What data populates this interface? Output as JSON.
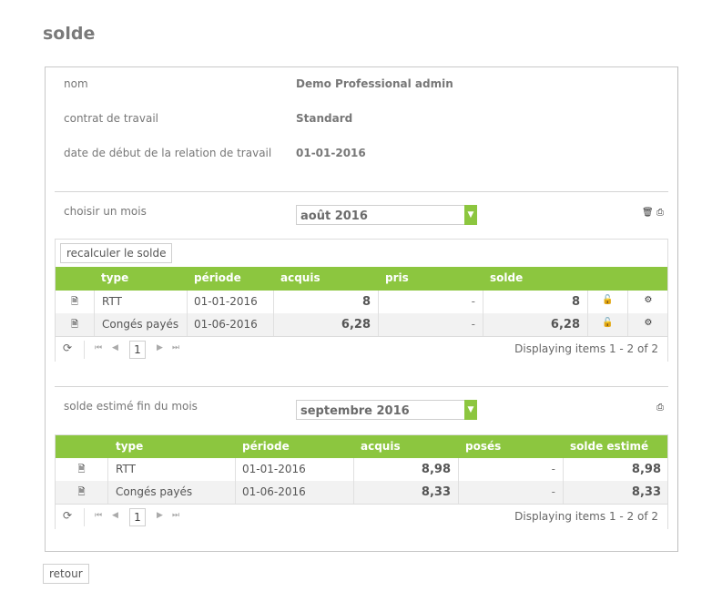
{
  "page": {
    "title": "solde"
  },
  "info": {
    "name_label": "nom",
    "name_value": "Demo Professional admin",
    "contract_label": "contrat de travail",
    "contract_value": "Standard",
    "start_label": "date de début de la relation de travail",
    "start_value": "01-01-2016"
  },
  "month": {
    "label": "choisir un mois",
    "selected": "août 2016",
    "recalc_button": "recalculer le solde"
  },
  "grid1": {
    "headers": [
      "type",
      "période",
      "acquis",
      "pris",
      "solde"
    ],
    "rows": [
      {
        "type": "RTT",
        "period": "01-01-2016",
        "acquired": "8",
        "taken": "-",
        "balance": "8"
      },
      {
        "type": "Congés payés",
        "period": "01-06-2016",
        "acquired": "6,28",
        "taken": "-",
        "balance": "6,28"
      }
    ],
    "page": "1",
    "info": "Displaying items 1 - 2 of 2"
  },
  "estimate": {
    "label": "solde estimé fin du mois",
    "selected": "septembre 2016"
  },
  "grid2": {
    "headers": [
      "type",
      "période",
      "acquis",
      "posés",
      "solde estimé"
    ],
    "rows": [
      {
        "type": "RTT",
        "period": "01-01-2016",
        "acquired": "8,98",
        "posed": "-",
        "estimated": "8,98"
      },
      {
        "type": "Congés payés",
        "period": "01-06-2016",
        "acquired": "8,33",
        "posed": "-",
        "estimated": "8,33"
      }
    ],
    "page": "1",
    "info": "Displaying items 1 - 2 of 2"
  },
  "footer": {
    "back_button": "retour"
  },
  "colors": {
    "accent": "#8cc63f"
  },
  "icons": {
    "delete": "trash-icon",
    "print": "printer-icon",
    "doc": "document-icon",
    "lock": "unlock-icon",
    "gear": "gear-icon",
    "refresh": "refresh-icon",
    "first": "first-page-icon",
    "prev": "prev-page-icon",
    "next": "next-page-icon",
    "last": "last-page-icon",
    "dropdown": "chevron-down-icon"
  }
}
